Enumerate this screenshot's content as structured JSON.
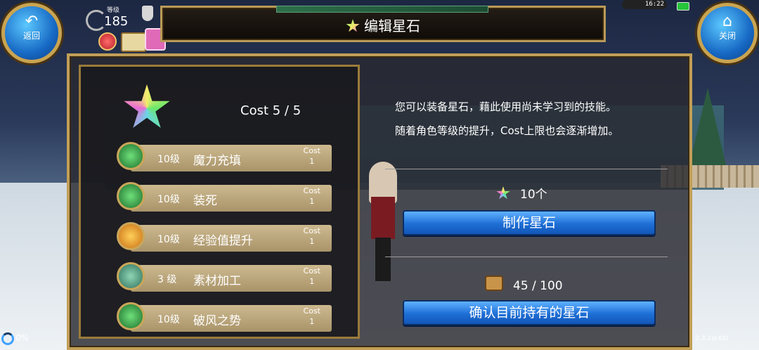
{
  "topbar": {
    "back_label": "返回",
    "close_label": "关闭",
    "title": "编辑星石",
    "level_label": "等级",
    "level_value": "185",
    "clock": "16:22"
  },
  "panel": {
    "cost_total": "Cost 5 / 5",
    "skills": [
      {
        "level": "10级",
        "name": "魔力充填",
        "cost_label": "Cost",
        "cost": "1",
        "icon": "magic-charge-icon"
      },
      {
        "level": "10级",
        "name": "装死",
        "cost_label": "Cost",
        "cost": "1",
        "icon": "play-dead-icon"
      },
      {
        "level": "10级",
        "name": "经验值提升",
        "cost_label": "Cost",
        "cost": "1",
        "icon": "exp-up-icon"
      },
      {
        "level": "3 级",
        "name": "素材加工",
        "cost_label": "Cost",
        "cost": "1",
        "icon": "material-craft-icon"
      },
      {
        "level": "10级",
        "name": "破风之势",
        "cost_label": "Cost",
        "cost": "1",
        "icon": "wind-break-icon"
      }
    ]
  },
  "info": {
    "desc_line1": "您可以装备星石，藉此使用尚未学习到的技能。",
    "desc_line2": "随着角色等级的提升，Cost上限也会逐渐增加。",
    "stone_count": "10个",
    "make_button": "制作星石",
    "inventory_count": "45 / 100",
    "confirm_button": "确认目前持有的星石"
  },
  "footer": {
    "load_percent": "0%",
    "version": "2.3.2a(48)"
  }
}
